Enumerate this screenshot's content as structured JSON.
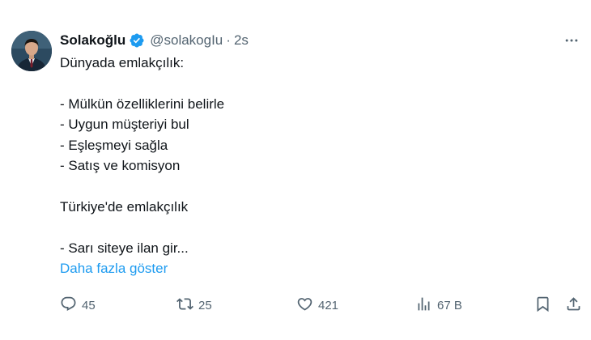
{
  "author": {
    "display_name": "Solakoğlu",
    "handle": "@solakogIu",
    "separator": "·",
    "time": "2s"
  },
  "tweet": {
    "lines": [
      "Dünyada emlakçılık:",
      "",
      "- Mülkün özelliklerini belirle",
      "- Uygun müşteriyi bul",
      "- Eşleşmeyi sağla",
      "- Satış ve komisyon",
      "",
      "Türkiye'de emlakçılık",
      "",
      "- Sarı siteye ilan gir..."
    ],
    "show_more": "Daha fazla göster"
  },
  "actions": {
    "replies": "45",
    "retweets": "25",
    "likes": "421",
    "views": "67 B"
  },
  "colors": {
    "text": "#0f1419",
    "secondary": "#536471",
    "accent": "#1d9bf0"
  },
  "icons": [
    "verified-badge-icon",
    "more-icon",
    "reply-icon",
    "retweet-icon",
    "like-icon",
    "views-icon",
    "bookmark-icon",
    "share-icon"
  ]
}
